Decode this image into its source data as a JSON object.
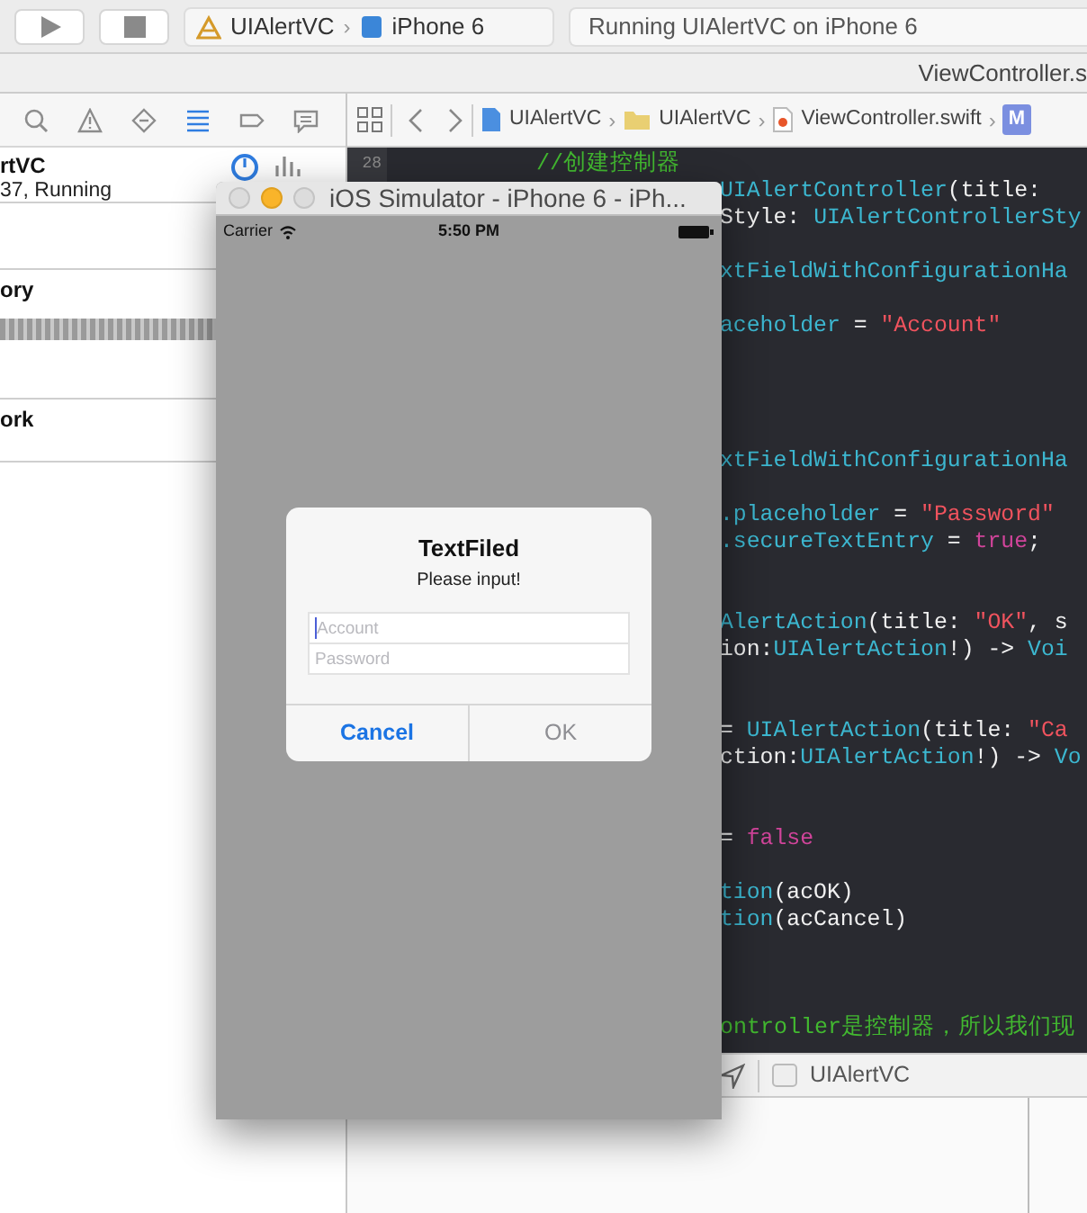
{
  "toolbar": {
    "scheme": {
      "project": "UIAlertVC",
      "separator": "›",
      "device": "iPhone 6"
    },
    "activity": "Running UIAlertVC on iPhone 6"
  },
  "tab_bar": {
    "open_file": "ViewController.s"
  },
  "navigator": {
    "tabs": [
      {
        "selected": false
      },
      {
        "selected": false
      },
      {
        "selected": false
      },
      {
        "selected": true
      },
      {
        "selected": false
      },
      {
        "selected": false
      }
    ],
    "rows": [
      {
        "kind": "process",
        "title": "rtVC",
        "subtitle": "37, Running"
      },
      {
        "kind": "spacer"
      },
      {
        "kind": "bar",
        "title": "ory"
      },
      {
        "kind": "plain",
        "title": "ork"
      }
    ]
  },
  "jump_bar": {
    "path": [
      {
        "kind": "project",
        "label": "UIAlertVC"
      },
      {
        "kind": "folder",
        "label": "UIAlertVC"
      },
      {
        "kind": "swift",
        "label": "ViewController.swift"
      },
      {
        "kind": "symbol",
        "label": "M"
      }
    ],
    "separator": "›"
  },
  "editor": {
    "line_numbers": [
      "28"
    ],
    "lines": [
      {
        "kind": "head",
        "segments": [
          {
            "kind": "comment",
            "text": "//创建控制器"
          }
        ]
      },
      {
        "kind": "code",
        "segments": [
          {
            "kind": "type",
            "text": "UIAlertController"
          },
          {
            "kind": "plain",
            "text": "(title:"
          }
        ]
      },
      {
        "kind": "code",
        "segments": [
          {
            "kind": "plain",
            "text": "Style: "
          },
          {
            "kind": "type",
            "text": "UIAlertControllerSty"
          }
        ]
      },
      {
        "kind": "blank"
      },
      {
        "kind": "code",
        "segments": [
          {
            "kind": "type",
            "text": "xtFieldWithConfigurationHa"
          }
        ]
      },
      {
        "kind": "blank"
      },
      {
        "kind": "code",
        "segments": [
          {
            "kind": "type",
            "text": "aceholder"
          },
          {
            "kind": "plain",
            "text": " = "
          },
          {
            "kind": "string",
            "text": "\"Account\""
          }
        ]
      },
      {
        "kind": "blank"
      },
      {
        "kind": "blank"
      },
      {
        "kind": "blank"
      },
      {
        "kind": "blank"
      },
      {
        "kind": "code",
        "segments": [
          {
            "kind": "type",
            "text": "xtFieldWithConfigurationHa"
          }
        ]
      },
      {
        "kind": "blank"
      },
      {
        "kind": "code",
        "segments": [
          {
            "kind": "type",
            "text": ".placeholder"
          },
          {
            "kind": "plain",
            "text": " = "
          },
          {
            "kind": "string",
            "text": "\"Password\""
          }
        ]
      },
      {
        "kind": "code",
        "segments": [
          {
            "kind": "type",
            "text": ".secureTextEntry"
          },
          {
            "kind": "plain",
            "text": " = "
          },
          {
            "kind": "keyword",
            "text": "true"
          },
          {
            "kind": "plain",
            "text": ";"
          }
        ]
      },
      {
        "kind": "blank"
      },
      {
        "kind": "blank"
      },
      {
        "kind": "code",
        "segments": [
          {
            "kind": "type",
            "text": "AlertAction"
          },
          {
            "kind": "plain",
            "text": "(title: "
          },
          {
            "kind": "string",
            "text": "\"OK\""
          },
          {
            "kind": "plain",
            "text": ", s"
          }
        ]
      },
      {
        "kind": "code",
        "segments": [
          {
            "kind": "plain",
            "text": "ion:"
          },
          {
            "kind": "type",
            "text": "UIAlertAction"
          },
          {
            "kind": "plain",
            "text": "!) -> "
          },
          {
            "kind": "type",
            "text": "Voi"
          }
        ]
      },
      {
        "kind": "blank"
      },
      {
        "kind": "blank"
      },
      {
        "kind": "code",
        "segments": [
          {
            "kind": "plain",
            "text": "= "
          },
          {
            "kind": "type",
            "text": "UIAlertAction"
          },
          {
            "kind": "plain",
            "text": "(title: "
          },
          {
            "kind": "string",
            "text": "\"Ca"
          }
        ]
      },
      {
        "kind": "code",
        "segments": [
          {
            "kind": "plain",
            "text": "ction:"
          },
          {
            "kind": "type",
            "text": "UIAlertAction"
          },
          {
            "kind": "plain",
            "text": "!) -> "
          },
          {
            "kind": "type",
            "text": "Vo"
          }
        ]
      },
      {
        "kind": "blank"
      },
      {
        "kind": "blank"
      },
      {
        "kind": "code",
        "segments": [
          {
            "kind": "plain",
            "text": "= "
          },
          {
            "kind": "keyword",
            "text": "false"
          }
        ]
      },
      {
        "kind": "blank"
      },
      {
        "kind": "code",
        "segments": [
          {
            "kind": "type",
            "text": "tion"
          },
          {
            "kind": "plain",
            "text": "(acOK)"
          }
        ]
      },
      {
        "kind": "code",
        "segments": [
          {
            "kind": "type",
            "text": "tion"
          },
          {
            "kind": "plain",
            "text": "(acCancel)"
          }
        ]
      },
      {
        "kind": "blank"
      },
      {
        "kind": "blank"
      },
      {
        "kind": "blank"
      },
      {
        "kind": "code",
        "segments": [
          {
            "kind": "comment",
            "text": "ontroller是控制器，所以我们现"
          }
        ]
      }
    ]
  },
  "debug_bar": {
    "target": "UIAlertVC"
  },
  "simulator": {
    "title": "iOS Simulator - iPhone 6 - iPh...",
    "status_bar": {
      "carrier": "Carrier",
      "time": "5:50 PM"
    },
    "alert": {
      "title": "TextFiled",
      "message": "Please input!",
      "fields": [
        {
          "placeholder": "Account",
          "focused": true
        },
        {
          "placeholder": "Password",
          "focused": false
        }
      ],
      "actions": [
        {
          "label": "Cancel",
          "disabled": false
        },
        {
          "label": "OK",
          "disabled": true
        }
      ]
    }
  }
}
